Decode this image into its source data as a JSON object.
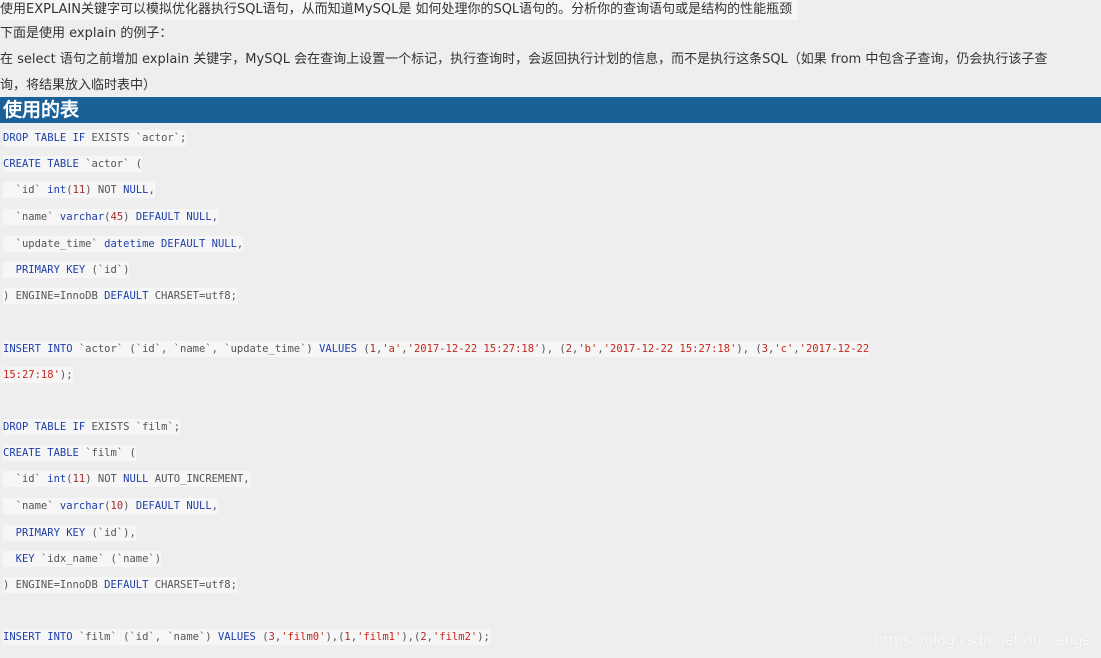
{
  "intro": {
    "line1": "使用EXPLAIN关键字可以模拟优化器执行SQL语句，从而知道MySQL是 如何处理你的SQL语句的。分析你的查询语句或是结构的性能瓶颈",
    "line2": "下面是使用 explain 的例子：",
    "line3": "在 select 语句之前增加 explain 关键字，MySQL 会在查询上设置一个标记，执行查询时，会返回执行计划的信息，而不是执行这条SQL（如果 from 中包含子查询，仍会执行该子查",
    "line4": "询，将结果放入临时表中）"
  },
  "section_heading": "使用的表",
  "code": {
    "l01": [
      [
        "kw",
        "DROP TABLE IF "
      ],
      [
        "kw2",
        "EXISTS "
      ],
      [
        "plain",
        "`actor`;"
      ]
    ],
    "l02": [
      [
        "kw",
        "CREATE TABLE "
      ],
      [
        "plain",
        "`actor` ("
      ]
    ],
    "l03": [
      [
        "plain",
        "  `id` "
      ],
      [
        "kw",
        "int"
      ],
      [
        "plain",
        "("
      ],
      [
        "num",
        "11"
      ],
      [
        "plain",
        ") "
      ],
      [
        "kw2",
        "NOT "
      ],
      [
        "kw",
        "NULL"
      ],
      [
        "plain",
        ","
      ]
    ],
    "l04": [
      [
        "plain",
        "  `name` "
      ],
      [
        "kw",
        "varchar"
      ],
      [
        "plain",
        "("
      ],
      [
        "num",
        "45"
      ],
      [
        "plain",
        ") "
      ],
      [
        "kw",
        "DEFAULT NULL"
      ],
      [
        "plain",
        ","
      ]
    ],
    "l05": [
      [
        "plain",
        "  `update_time` "
      ],
      [
        "kw",
        "datetime DEFAULT NULL"
      ],
      [
        "plain",
        ","
      ]
    ],
    "l06": [
      [
        "plain",
        "  "
      ],
      [
        "kw",
        "PRIMARY KEY "
      ],
      [
        "plain",
        "(`id`)"
      ]
    ],
    "l07": [
      [
        "plain",
        ") ENGINE=InnoDB "
      ],
      [
        "kw",
        "DEFAULT "
      ],
      [
        "plain",
        "CHARSET=utf8;"
      ]
    ],
    "l08": [
      [
        "kw",
        "INSERT INTO "
      ],
      [
        "plain",
        "`actor` (`id`, `name`, `update_time`) "
      ],
      [
        "kw",
        "VALUES "
      ],
      [
        "plain",
        "("
      ],
      [
        "num",
        "1"
      ],
      [
        "plain",
        ","
      ],
      [
        "str",
        "'a'"
      ],
      [
        "plain",
        ","
      ],
      [
        "str",
        "'2017-12-22 15:27:18'"
      ],
      [
        "plain",
        "), ("
      ],
      [
        "num",
        "2"
      ],
      [
        "plain",
        ","
      ],
      [
        "str",
        "'b'"
      ],
      [
        "plain",
        ","
      ],
      [
        "str",
        "'2017-12-22 15:27:18'"
      ],
      [
        "plain",
        "), ("
      ],
      [
        "num",
        "3"
      ],
      [
        "plain",
        ","
      ],
      [
        "str",
        "'c'"
      ],
      [
        "plain",
        ","
      ],
      [
        "str",
        "'2017-12-22"
      ]
    ],
    "l09": [
      [
        "str",
        "15:27:18'"
      ],
      [
        "plain",
        ");"
      ]
    ],
    "l10": [
      [
        "kw",
        "DROP TABLE IF "
      ],
      [
        "kw2",
        "EXISTS "
      ],
      [
        "plain",
        "`film`;"
      ]
    ],
    "l11": [
      [
        "kw",
        "CREATE TABLE "
      ],
      [
        "plain",
        "`film` ("
      ]
    ],
    "l12": [
      [
        "plain",
        "  `id` "
      ],
      [
        "kw",
        "int"
      ],
      [
        "plain",
        "("
      ],
      [
        "num",
        "11"
      ],
      [
        "plain",
        ") "
      ],
      [
        "kw2",
        "NOT "
      ],
      [
        "kw",
        "NULL "
      ],
      [
        "plain",
        "AUTO_INCREMENT,"
      ]
    ],
    "l13": [
      [
        "plain",
        "  `name` "
      ],
      [
        "kw",
        "varchar"
      ],
      [
        "plain",
        "("
      ],
      [
        "num",
        "10"
      ],
      [
        "plain",
        ") "
      ],
      [
        "kw",
        "DEFAULT NULL"
      ],
      [
        "plain",
        ","
      ]
    ],
    "l14": [
      [
        "plain",
        "  "
      ],
      [
        "kw",
        "PRIMARY KEY "
      ],
      [
        "plain",
        "(`id`),"
      ]
    ],
    "l15": [
      [
        "plain",
        "  "
      ],
      [
        "kw",
        "KEY "
      ],
      [
        "plain",
        "`idx_name` (`name`)"
      ]
    ],
    "l16": [
      [
        "plain",
        ") ENGINE=InnoDB "
      ],
      [
        "kw",
        "DEFAULT "
      ],
      [
        "plain",
        "CHARSET=utf8;"
      ]
    ],
    "l17": [
      [
        "kw",
        "INSERT INTO "
      ],
      [
        "plain",
        "`film` (`id`, `name`) "
      ],
      [
        "kw",
        "VALUES "
      ],
      [
        "plain",
        "("
      ],
      [
        "num",
        "3"
      ],
      [
        "plain",
        ","
      ],
      [
        "str",
        "'film0'"
      ],
      [
        "plain",
        "),("
      ],
      [
        "num",
        "1"
      ],
      [
        "plain",
        ","
      ],
      [
        "str",
        "'film1'"
      ],
      [
        "plain",
        "),("
      ],
      [
        "num",
        "2"
      ],
      [
        "plain",
        ","
      ],
      [
        "str",
        "'film2'"
      ],
      [
        "plain",
        ");"
      ]
    ]
  },
  "watermark": "https://blog.csdn.net/du_senge"
}
